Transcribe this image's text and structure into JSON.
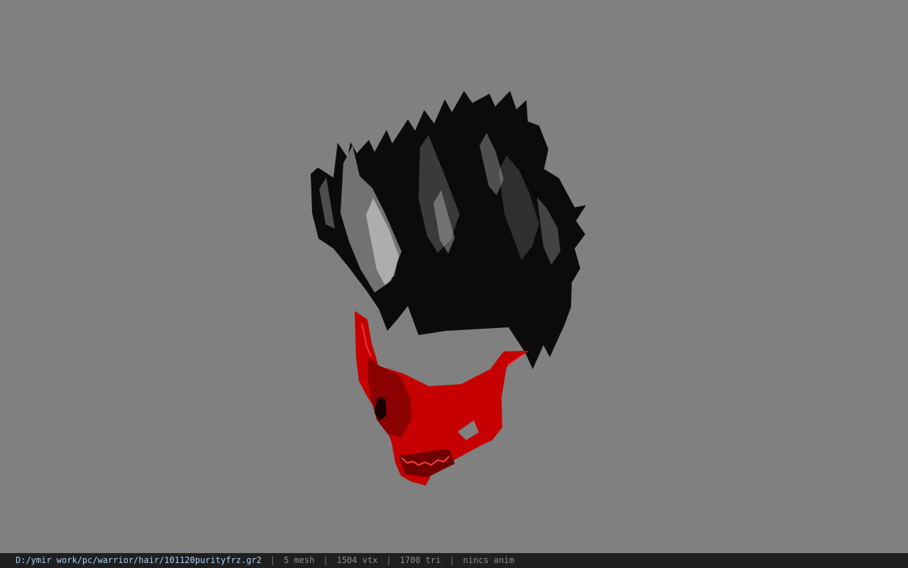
{
  "viewport": {
    "background": "#808080",
    "model_parts": [
      {
        "name": "spiky-hair",
        "color": "#0b0b0b"
      },
      {
        "name": "red-skull-mask",
        "color": "#c40000"
      }
    ]
  },
  "statusbar": {
    "path": "D:/ymir work/pc/warrior/hair/101120purityfrz.gr2",
    "sep": "|",
    "mesh": "5 mesh",
    "vtx": "1504 vtx",
    "tri": "1700 tri",
    "anim": "nincs anim"
  }
}
